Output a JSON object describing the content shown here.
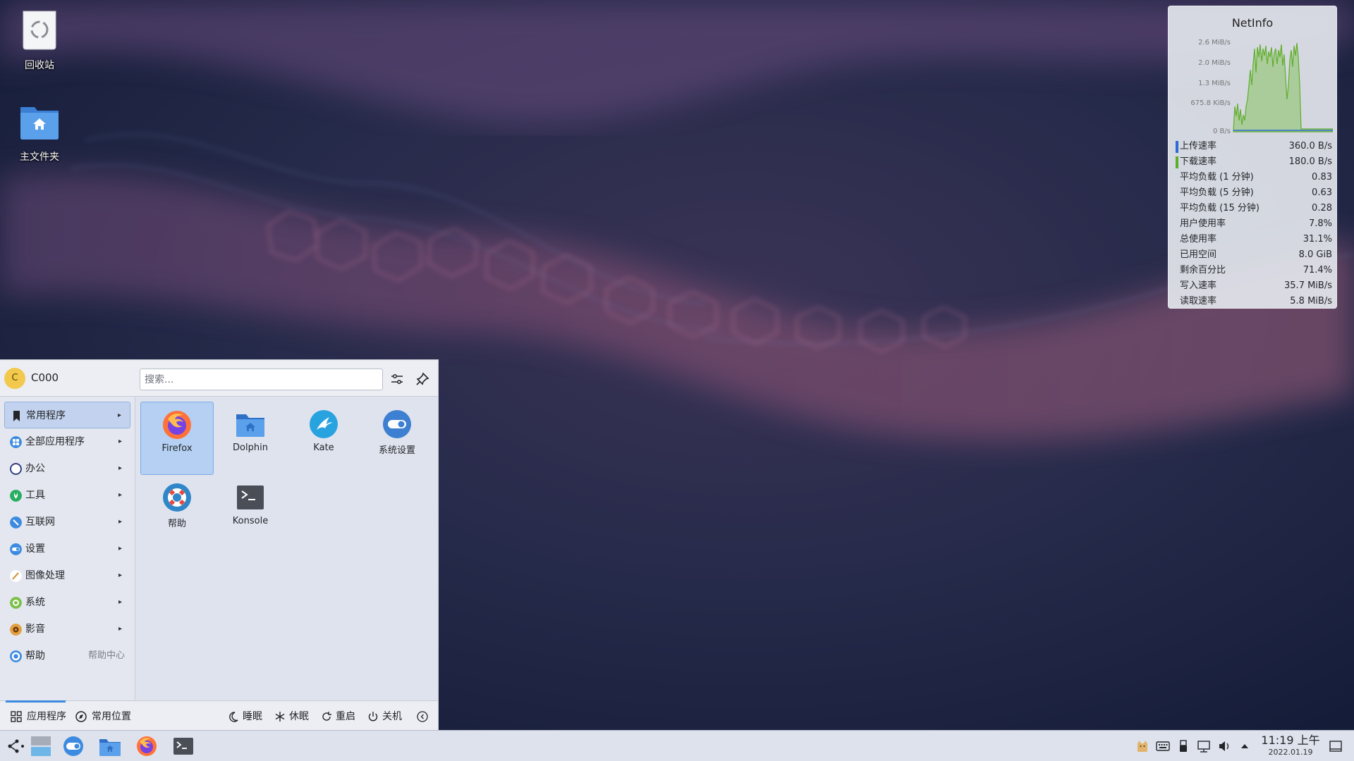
{
  "desktop": {
    "icons": [
      {
        "label": "回收站",
        "icon": "trash-icon"
      },
      {
        "label": "主文件夹",
        "icon": "home-folder-icon"
      }
    ]
  },
  "netinfo": {
    "title": "NetInfo",
    "graph_axis": [
      "2.6 MiB/s",
      "2.0 MiB/s",
      "1.3 MiB/s",
      "675.8 KiB/s",
      "0 B/s"
    ],
    "upload_color": "#2e6bd6",
    "download_color": "#5fae2a",
    "rows": [
      {
        "label": "上传速率",
        "value": "360.0 B/s"
      },
      {
        "label": "下载速率",
        "value": "180.0 B/s"
      },
      {
        "label": "平均负载 (1 分钟)",
        "value": "0.83"
      },
      {
        "label": "平均负载 (5 分钟)",
        "value": "0.63"
      },
      {
        "label": "平均负载 (15 分钟)",
        "value": "0.28"
      },
      {
        "label": "用户使用率",
        "value": "7.8%"
      },
      {
        "label": "总使用率",
        "value": "31.1%"
      },
      {
        "label": "已用空间",
        "value": "8.0 GiB"
      },
      {
        "label": "剩余百分比",
        "value": "71.4%"
      },
      {
        "label": "写入速率",
        "value": "35.7 MiB/s"
      },
      {
        "label": "读取速率",
        "value": "5.8 MiB/s"
      }
    ]
  },
  "launcher": {
    "user": {
      "initial": "C",
      "name": "C000"
    },
    "search_placeholder": "搜索...",
    "categories": [
      {
        "label": "常用程序",
        "icon": "bookmark-icon",
        "color": "#232629",
        "arrow": "▸"
      },
      {
        "label": "全部应用程序",
        "icon": "all-apps-icon",
        "color": "#3d8be0",
        "arrow": "▸"
      },
      {
        "label": "办公",
        "icon": "office-icon",
        "color": "#ffffff",
        "arrow": "▸"
      },
      {
        "label": "工具",
        "icon": "tools-icon",
        "color": "#27ae60",
        "arrow": "▸"
      },
      {
        "label": "互联网",
        "icon": "internet-icon",
        "color": "#3d8be0",
        "arrow": "▸"
      },
      {
        "label": "设置",
        "icon": "settings-icon",
        "color": "#3d8be0",
        "arrow": "▸"
      },
      {
        "label": "图像处理",
        "icon": "graphics-icon",
        "color": "#ffffff",
        "arrow": "▸"
      },
      {
        "label": "系统",
        "icon": "system-icon",
        "color": "#7cc04a",
        "arrow": "▸"
      },
      {
        "label": "影音",
        "icon": "multimedia-icon",
        "color": "#e2a03f",
        "arrow": "▸"
      },
      {
        "label": "帮助",
        "icon": "help-icon",
        "color": "#3d8be0",
        "sub": "帮助中心"
      }
    ],
    "apps": [
      {
        "label": "Firefox",
        "icon": "firefox-icon"
      },
      {
        "label": "Dolphin",
        "icon": "dolphin-icon"
      },
      {
        "label": "Kate",
        "icon": "kate-icon"
      },
      {
        "label": "系统设置",
        "icon": "system-settings-icon"
      },
      {
        "label": "帮助",
        "icon": "help-lifebuoy-icon"
      },
      {
        "label": "Konsole",
        "icon": "konsole-icon"
      }
    ],
    "footer": {
      "tab_apps": "应用程序",
      "tab_places": "常用位置",
      "sleep": "睡眠",
      "hibernate": "休眠",
      "restart": "重启",
      "shutdown": "关机"
    }
  },
  "taskbar": {
    "time": "11:19 上午",
    "date": "2022.01.19"
  }
}
